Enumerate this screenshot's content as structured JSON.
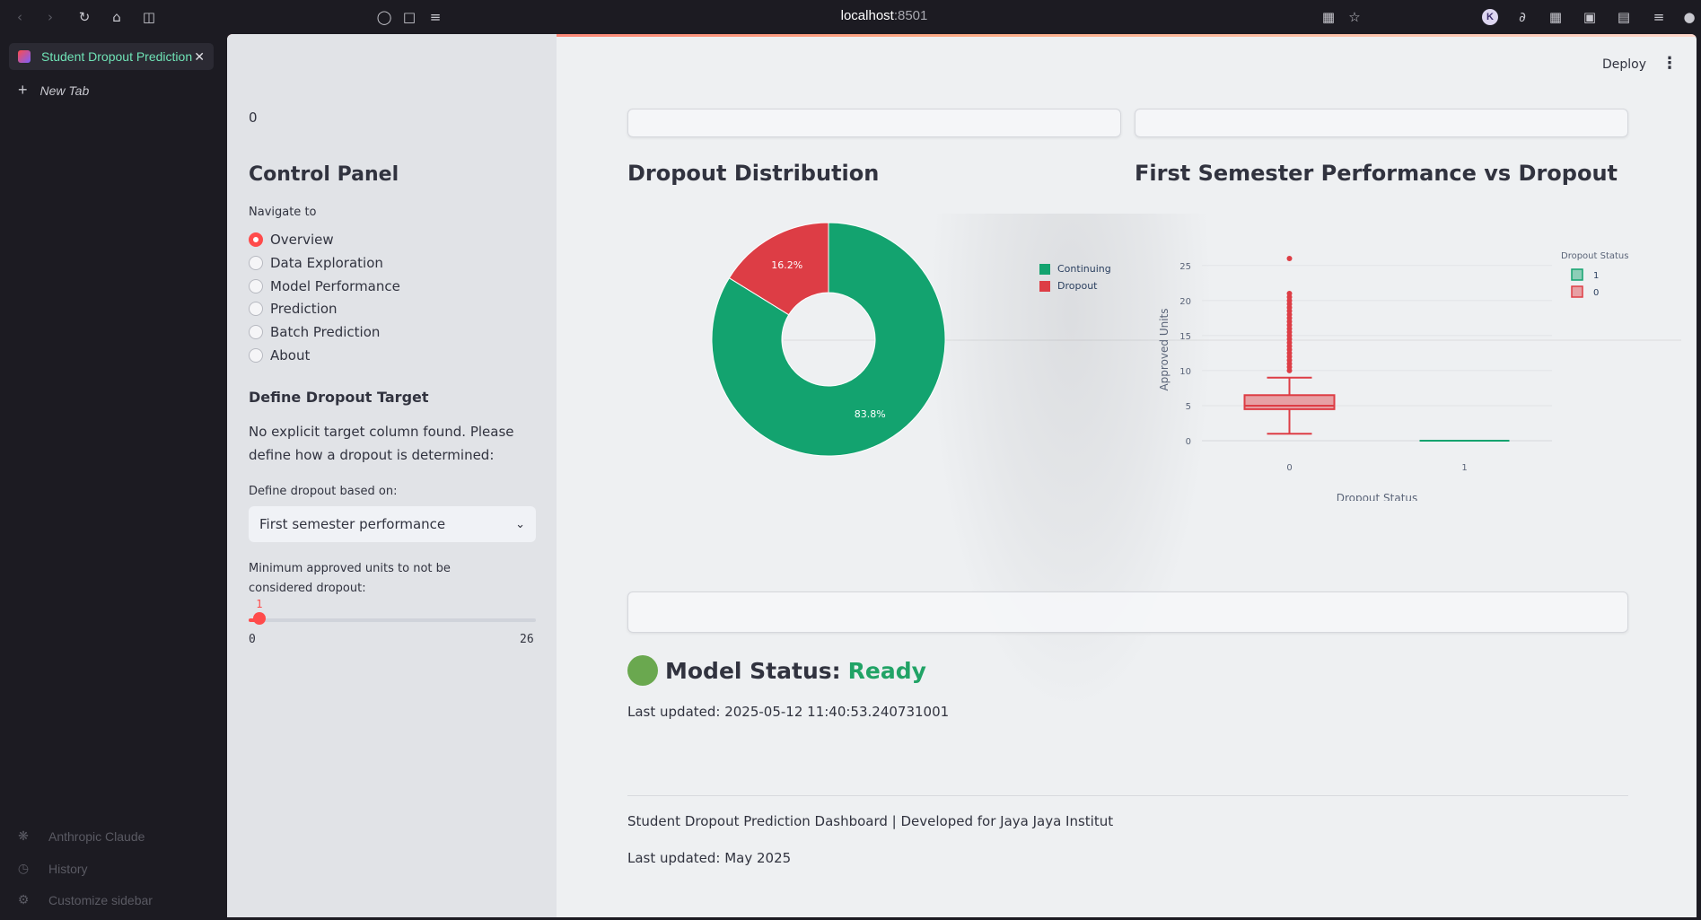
{
  "browser": {
    "url_host": "localhost",
    "url_port": ":8501",
    "profile_initial": "K"
  },
  "browser_sidebar": {
    "active_tab_title": "Student Dropout Prediction",
    "new_tab_label": "New Tab",
    "bottom_items": [
      "Anthropic Claude",
      "History",
      "Customize sidebar"
    ]
  },
  "toolbar": {
    "deploy_label": "Deploy"
  },
  "sidebar": {
    "top_value": "0",
    "title": "Control Panel",
    "nav_label": "Navigate to",
    "nav_items": [
      "Overview",
      "Data Exploration",
      "Model Performance",
      "Prediction",
      "Batch Prediction",
      "About"
    ],
    "nav_selected": "Overview",
    "define_title": "Define Dropout Target",
    "define_description": "No explicit target column found. Please define how a dropout is determined:",
    "select_label": "Define dropout based on:",
    "select_value": "First semester performance",
    "slider_label": "Minimum approved units to not be considered dropout:",
    "slider_value": "1",
    "slider_min": "0",
    "slider_max": "26"
  },
  "main": {
    "pie_title": "Dropout Distribution",
    "box_title": "First Semester Performance vs Dropout",
    "status_prefix": "Model Status:",
    "status_value": "Ready",
    "last_updated_line": "Last updated: 2025-05-12 11:40:53.240731001",
    "footer_line1": "Student Dropout Prediction Dashboard | Developed for Jaya Jaya Institut",
    "footer_line2": "Last updated: May 2025"
  },
  "colors": {
    "continuing": "#13a36f",
    "dropout": "#dd3d45",
    "accent": "#ff4b4b",
    "ready": "#21a366"
  },
  "chart_data": [
    {
      "type": "pie",
      "hole": true,
      "labels": [
        "Continuing",
        "Dropout"
      ],
      "values": [
        83.8,
        16.2
      ],
      "value_labels": [
        "83.8%",
        "16.2%"
      ],
      "legend": [
        "Continuing",
        "Dropout"
      ],
      "legend_position": "right"
    },
    {
      "type": "box",
      "xlabel": "Dropout Status",
      "ylabel": "Approved Units",
      "categories": [
        "0",
        "1"
      ],
      "ylim": [
        0,
        26
      ],
      "yticks": [
        0,
        5,
        10,
        15,
        20,
        25
      ],
      "legend_title": "Dropout Status",
      "legend": [
        "1",
        "0"
      ],
      "series": [
        {
          "name": "0",
          "min": 1,
          "q1": 4.5,
          "median": 5,
          "q3": 6.5,
          "max": 9,
          "outliers": [
            10,
            10.5,
            11,
            11.5,
            12,
            12.5,
            13,
            13.5,
            14,
            14.5,
            15,
            15.5,
            16,
            16.5,
            17,
            17.5,
            18,
            18.5,
            19,
            19.5,
            20,
            20.5,
            21,
            26
          ]
        },
        {
          "name": "1",
          "min": 0,
          "q1": 0,
          "median": 0,
          "q3": 0,
          "max": 0,
          "outliers": []
        }
      ],
      "grid": true
    }
  ]
}
